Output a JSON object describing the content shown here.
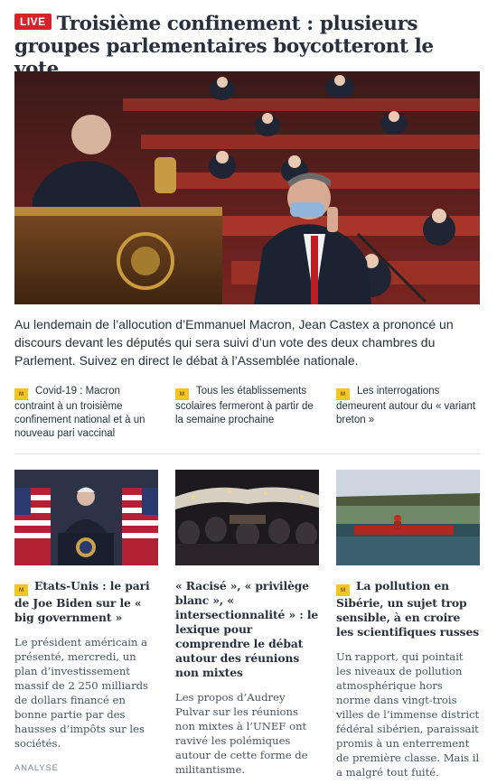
{
  "main": {
    "live_label": "LIVE",
    "title": "Troisième confinement : plusieurs groupes parlementaires boycotteront le vote",
    "lede": "Au lendemain de l’allocution d’Emmanuel Macron, Jean Castex a prononcé un discours devant les députés qui sera suivi d’un vote des deux chambres du Parlement. Suivez en direct le débat à l’Assemblée nationale."
  },
  "related": [
    {
      "label": "Covid-19 : Macron contraint à un troisième confinement national et à un nouveau pari vaccinal",
      "icon": "le-monde-badge-icon"
    },
    {
      "label": "Tous les établissements scolaires fermeront à partir de la semaine prochaine",
      "icon": "le-monde-badge-icon"
    },
    {
      "label": "Les interrogations demeurent autour du « variant breton »",
      "icon": "le-monde-badge-icon"
    }
  ],
  "badge_text": "M",
  "cards": [
    {
      "title": "Etats-Unis : le pari de Joe Biden sur le « big government »",
      "desc": "Le président américain a présenté, mercredi, un plan d’investissement massif de 2 250 milliards de dollars financé en bonne partie par des hausses d’impôts sur les sociétés.",
      "tag": "ANALYSE"
    },
    {
      "title": "« Racisé », « privilège blanc », « intersectionnalité » : le lexique pour comprendre le débat autour des réunions non mixtes",
      "desc": "Les propos d’Audrey Pulvar sur les réunions non mixtes à l’UNEF ont ravivé les polémiques autour de cette forme de militantisme."
    },
    {
      "title": "La pollution en Sibérie, un sujet trop sensible, à en croire les scientifiques russes",
      "desc": "Un rapport, qui pointait les niveaux de pollution atmosphérique hors norme dans vingt-trois villes de l’immense district fédéral sibérien, paraissait promis à un enterrement de première classe. Mais il a malgré tout fuité."
    }
  ],
  "colors": {
    "live": "#d5222b",
    "badge": "#f4c51e",
    "text": "#2a303b"
  }
}
